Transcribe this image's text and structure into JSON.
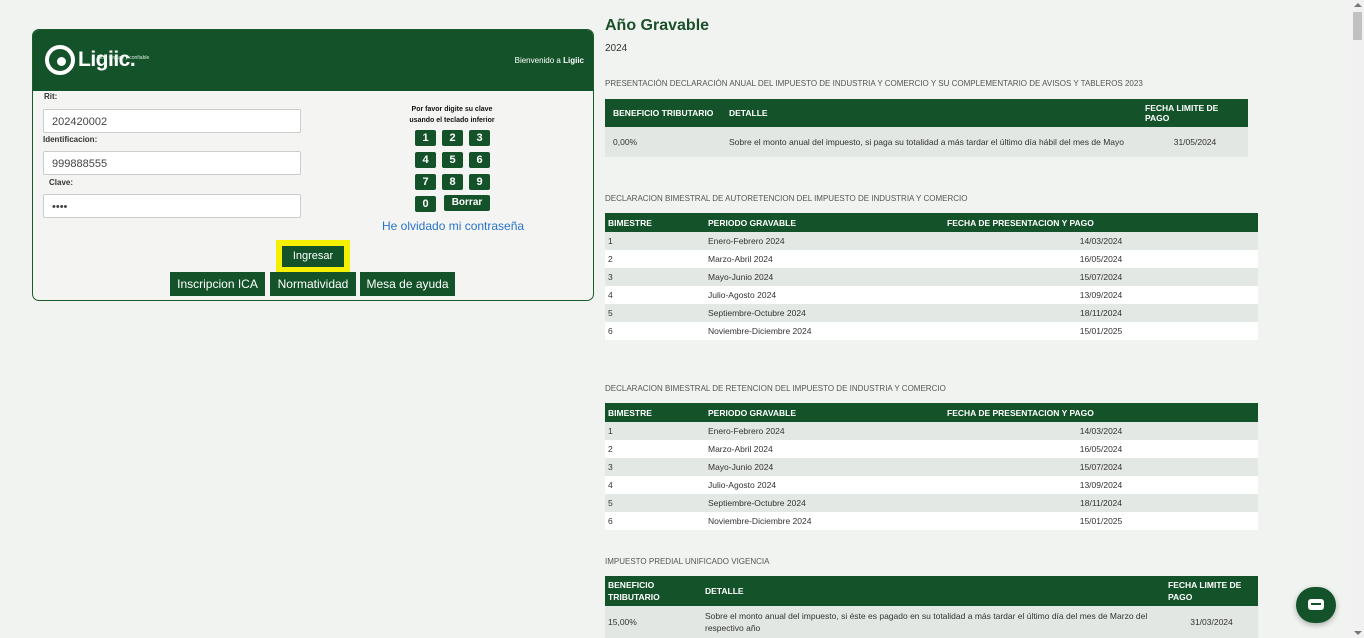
{
  "login": {
    "logo_text": "Ligiic.",
    "logo_tagline": "fácil, seguro y confiable",
    "welcome_prefix": "Bienvenido a",
    "welcome_brand": "Ligiic",
    "rit_label": "Rit:",
    "rit_value": "202420002",
    "id_label": "Identificacion:",
    "id_value": "999888555",
    "clave_label": "Clave:",
    "clave_value": "••••",
    "hint_line1": "Por favor digite su clave",
    "hint_line2": "usando el teclado inferior",
    "keys": [
      "1",
      "2",
      "3",
      "4",
      "5",
      "6",
      "7",
      "8",
      "9",
      "0"
    ],
    "borrar": "Borrar",
    "forgot": "He olvidado mi contraseña",
    "ingresar": "Ingresar",
    "buttons": [
      "Inscripcion ICA",
      "Normatividad",
      "Mesa de ayuda"
    ]
  },
  "info": {
    "title": "Año Gravable",
    "year": "2024",
    "sec1": "PRESENTACIÓN DECLARACIÓN ANUAL DEL IMPUESTO DE INDUSTRIA Y COMERCIO Y SU COMPLEMENTARIO DE AVISOS Y TABLEROS 2023",
    "t1_headers": [
      "BENEFICIO TRIBUTARIO",
      "DETALLE",
      "FECHA LIMITE DE PAGO"
    ],
    "t1_row": [
      "0,00%",
      "Sobre el monto anual del impuesto, si paga su totalidad a más tardar el último día hábil del mes de Mayo",
      "31/05/2024"
    ],
    "sec2": "DECLARACION BIMESTRAL DE AUTORETENCION DEL IMPUESTO DE INDUSTRIA Y COMERCIO",
    "sec3": "DECLARACION BIMESTRAL DE RETENCION DEL IMPUESTO DE INDUSTRIA Y COMERCIO",
    "bim_headers": [
      "BIMESTRE",
      "PERIODO GRAVABLE",
      "FECHA DE PRESENTACION Y PAGO"
    ],
    "bim_rows": [
      [
        "1",
        "Enero-Febrero 2024",
        "14/03/2024"
      ],
      [
        "2",
        "Marzo-Abril 2024",
        "16/05/2024"
      ],
      [
        "3",
        "Mayo-Junio 2024",
        "15/07/2024"
      ],
      [
        "4",
        "Julio-Agosto 2024",
        "13/09/2024"
      ],
      [
        "5",
        "Septiembre-Octubre 2024",
        "18/11/2024"
      ],
      [
        "6",
        "Noviembre-Diciembre 2024",
        "15/01/2025"
      ]
    ],
    "sec4": "IMPUESTO PREDIAL UNIFICADO VIGENCIA",
    "t4_headers": [
      "BENEFICIO TRIBUTARIO",
      "DETALLE",
      "FECHA LIMITE DE PAGO"
    ],
    "t4_row": [
      "15,00%",
      "Sobre el monto anual del impuesto, si éste es pagado en su totalidad a más tardar el último día del mes de Marzo del respectivo año",
      "31/03/2024"
    ]
  },
  "icons": {
    "chat": "chat-icon",
    "logo": "ligiic-logo"
  }
}
